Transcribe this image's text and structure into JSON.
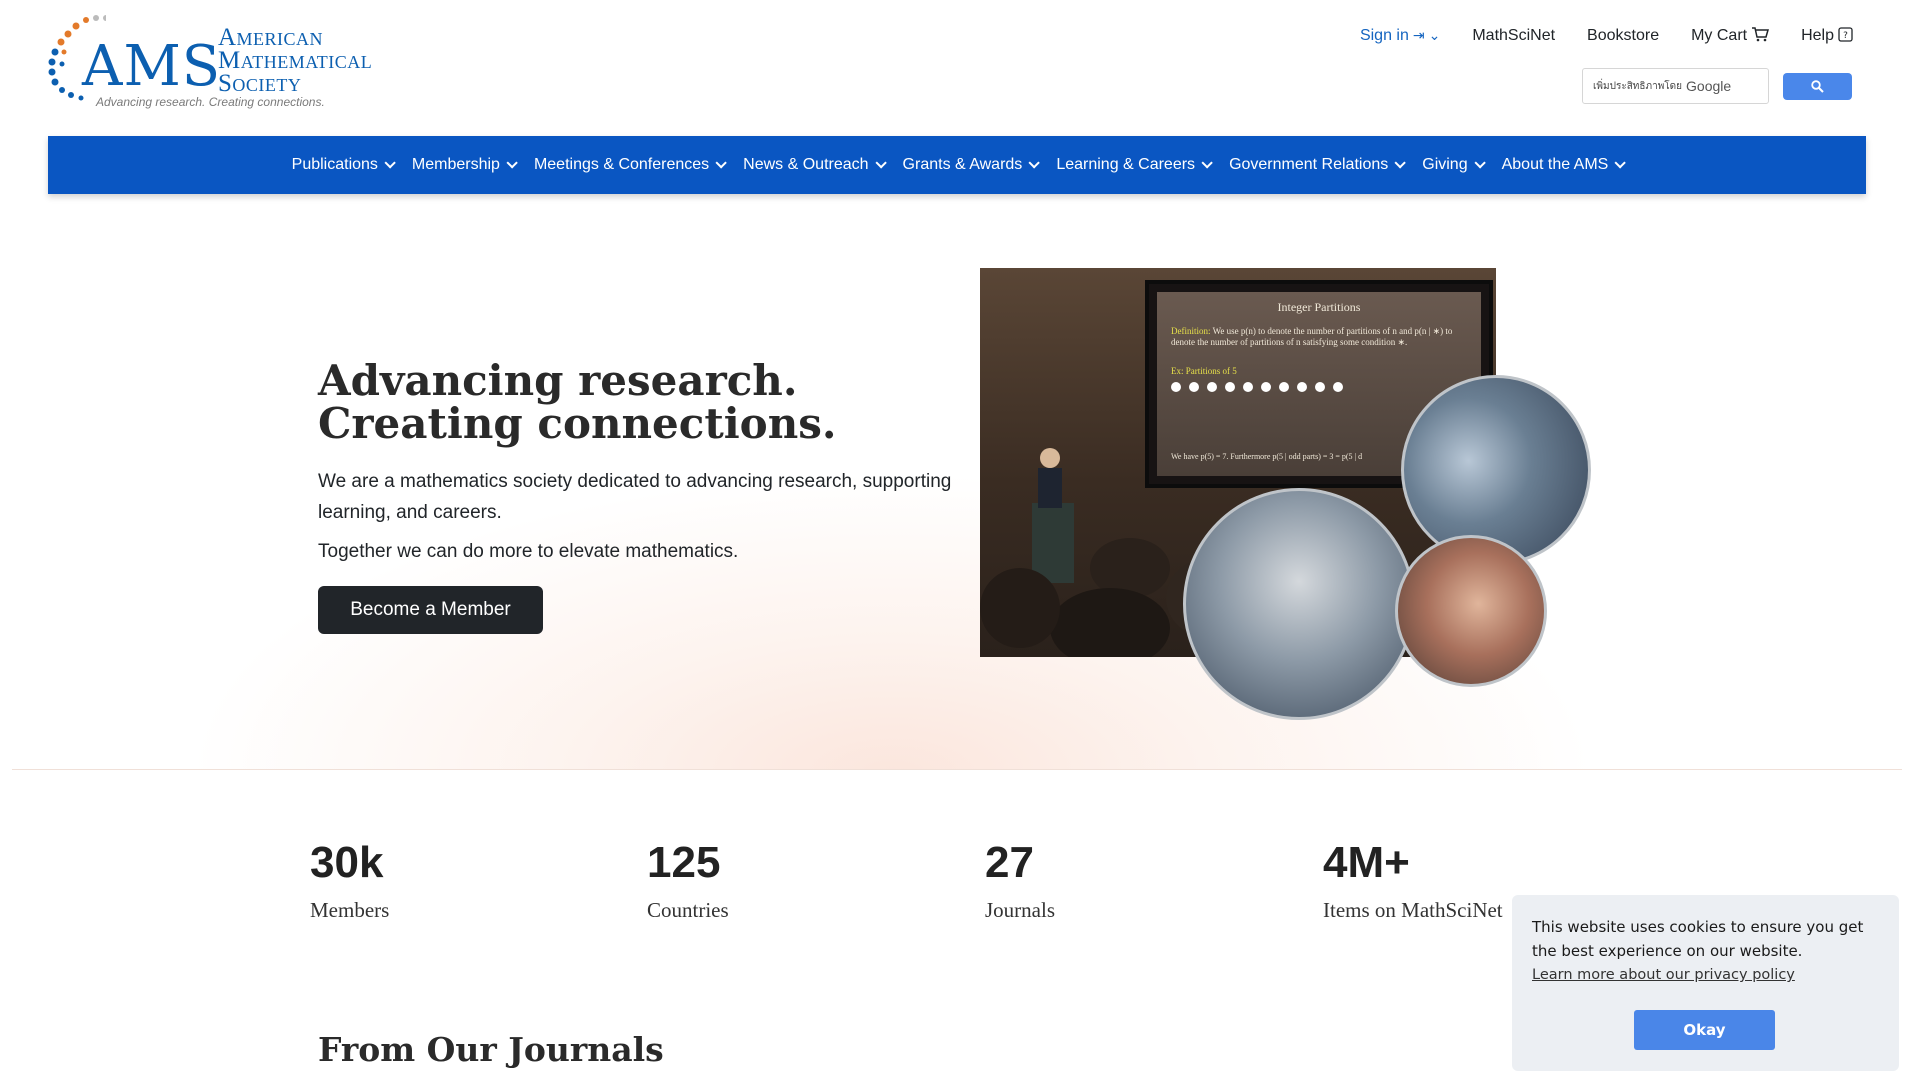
{
  "logo": {
    "abbr": "AMS",
    "name_line1": "American",
    "name_line2": "Mathematical",
    "name_line3": "Society",
    "tagline": "Advancing research. Creating connections.",
    "colors": {
      "blue": "#0c5fb0",
      "orange": "#e37a2a"
    }
  },
  "topnav": {
    "signin": "Sign in",
    "mathscinet": "MathSciNet",
    "bookstore": "Bookstore",
    "cart": "My Cart",
    "help": "Help"
  },
  "search": {
    "placeholder_lang": "เพิ่มประสิทธิภาพโดย",
    "provider": "Google",
    "button_icon": "search-icon"
  },
  "mainnav": [
    {
      "label": "Publications"
    },
    {
      "label": "Membership"
    },
    {
      "label": "Meetings & Conferences"
    },
    {
      "label": "News & Outreach"
    },
    {
      "label": "Grants & Awards"
    },
    {
      "label": "Learning & Careers"
    },
    {
      "label": "Government Relations"
    },
    {
      "label": "Giving"
    },
    {
      "label": "About the AMS"
    }
  ],
  "hero": {
    "title_line1": "Advancing research.",
    "title_line2": "Creating connections.",
    "para1": "We are a mathematics society dedicated to advancing research, supporting learning, and careers.",
    "para2": "Together we can do more to elevate mathematics.",
    "cta": "Become a Member",
    "slide": {
      "title": "Integer Partitions",
      "def_label": "Definition:",
      "def_text": "We use p(n) to denote the number of partitions of n and p(n | ∗) to denote the number of partitions of n satisfying some condition ∗.",
      "ex": "Ex: Partitions of 5",
      "footer": "We have p(5) = 7. Furthermore p(5 | odd parts) = 3 = p(5 | d"
    }
  },
  "stats": [
    {
      "value": "30k",
      "label": "Members"
    },
    {
      "value": "125",
      "label": "Countries"
    },
    {
      "value": "27",
      "label": "Journals"
    },
    {
      "value": "4M+",
      "label": "Items on MathSciNet"
    }
  ],
  "journals_heading": "From Our Journals",
  "cookie": {
    "message": "This website uses cookies to ensure you get the best experience on our website.",
    "link": "Learn more about our privacy policy",
    "ok": "Okay"
  }
}
